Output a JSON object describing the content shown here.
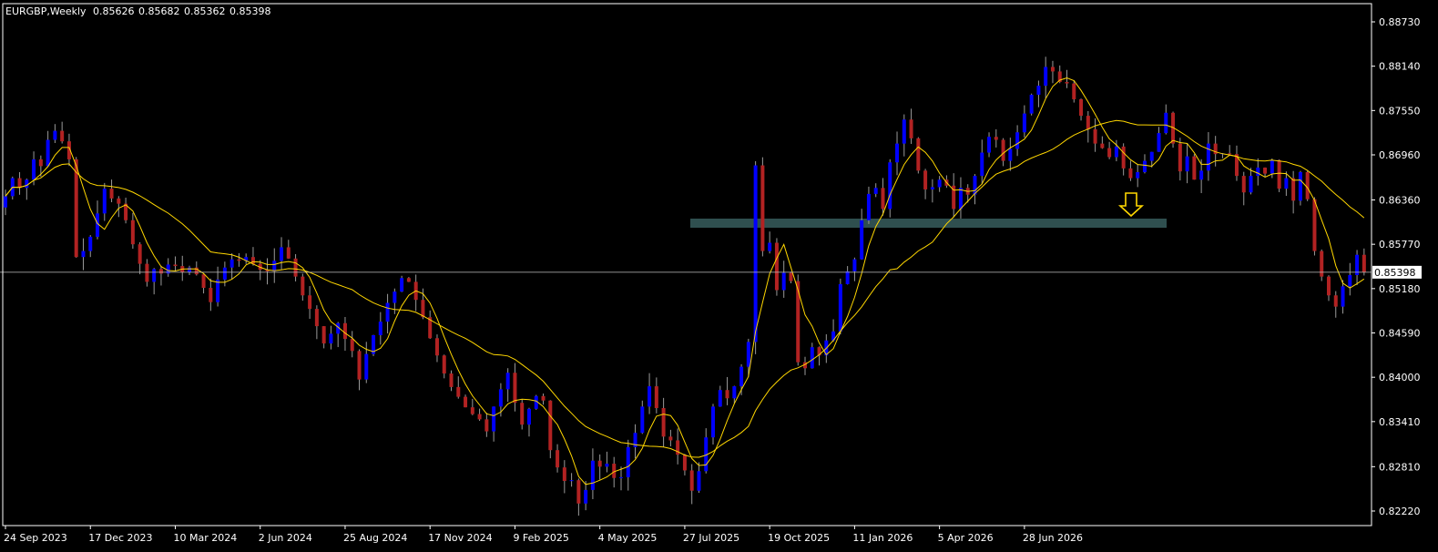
{
  "header": {
    "symbol": "EURGBP,Weekly",
    "ohlc": [
      "0.85626",
      "0.85682",
      "0.85362",
      "0.85398"
    ]
  },
  "colors": {
    "background": "#000000",
    "bull_candle": "#0000ff",
    "bear_candle": "#b22222",
    "wick": "#9a9a9a",
    "moving_averages": "#ffd700",
    "zone": "#2f4f4f",
    "arrow": "#ffd700",
    "price_line": "#c0c0c0",
    "axis": "#ffffff"
  },
  "icons": {
    "arrow": "down-arrow-icon"
  },
  "chart_data": {
    "type": "candlestick",
    "title": "EURGBP,Weekly",
    "ylim": [
      0.8196,
      0.8888
    ],
    "y_ticks": [
      "0.88730",
      "0.88140",
      "0.87550",
      "0.86960",
      "0.86360",
      "0.85770",
      "0.85180",
      "0.84590",
      "0.84000",
      "0.83410",
      "0.82810",
      "0.82220"
    ],
    "x_ticks": [
      "24 Sep 2023",
      "17 Dec 2023",
      "10 Mar 2024",
      "2 Jun 2024",
      "25 Aug 2024",
      "17 Nov 2024",
      "9 Feb 2025",
      "4 May 2025",
      "27 Jul 2025",
      "19 Oct 2025",
      "11 Jan 2026",
      "5 Apr 2026",
      "28 Jun 2026"
    ],
    "x_tick_bar_index": [
      0,
      12,
      24,
      36,
      48,
      60,
      72,
      84,
      96,
      108,
      120,
      132,
      144
    ],
    "current_price": "0.85398",
    "close": [
      0.8641,
      0.8665,
      0.8652,
      0.8663,
      0.869,
      0.8681,
      0.8716,
      0.8728,
      0.8714,
      0.869,
      0.856,
      0.8568,
      0.8587,
      0.8618,
      0.8651,
      0.8638,
      0.8631,
      0.8609,
      0.8577,
      0.8551,
      0.8527,
      0.8544,
      0.8538,
      0.855,
      0.8548,
      0.854,
      0.8546,
      0.8537,
      0.8519,
      0.85,
      0.853,
      0.8546,
      0.8557,
      0.8555,
      0.856,
      0.8551,
      0.8543,
      0.8541,
      0.8555,
      0.8573,
      0.8558,
      0.8534,
      0.8509,
      0.8491,
      0.8468,
      0.8445,
      0.8458,
      0.8472,
      0.8451,
      0.8435,
      0.8397,
      0.8431,
      0.8456,
      0.8474,
      0.8499,
      0.8514,
      0.8532,
      0.8527,
      0.8503,
      0.848,
      0.8452,
      0.8429,
      0.8405,
      0.8387,
      0.8374,
      0.836,
      0.8351,
      0.8344,
      0.8328,
      0.8361,
      0.8384,
      0.8406,
      0.8366,
      0.8337,
      0.8358,
      0.8375,
      0.8369,
      0.8303,
      0.828,
      0.8262,
      0.8263,
      0.8232,
      0.825,
      0.8289,
      0.8281,
      0.8285,
      0.8266,
      0.8267,
      0.8307,
      0.8326,
      0.8361,
      0.8388,
      0.8359,
      0.8321,
      0.8316,
      0.8297,
      0.8276,
      0.8249,
      0.8275,
      0.832,
      0.8361,
      0.8383,
      0.8372,
      0.8388,
      0.8414,
      0.8447,
      0.8682,
      0.8568,
      0.8579,
      0.8516,
      0.8539,
      0.8528,
      0.842,
      0.8412,
      0.844,
      0.8429,
      0.8449,
      0.8461,
      0.8524,
      0.8541,
      0.8557,
      0.8609,
      0.8644,
      0.8652,
      0.8624,
      0.8686,
      0.8711,
      0.8743,
      0.8718,
      0.8675,
      0.865,
      0.8653,
      0.8663,
      0.8655,
      0.8624,
      0.8652,
      0.8643,
      0.8668,
      0.8699,
      0.872,
      0.8716,
      0.8688,
      0.8704,
      0.8726,
      0.8751,
      0.8776,
      0.8788,
      0.8813,
      0.8807,
      0.8793,
      0.8791,
      0.877,
      0.8748,
      0.873,
      0.8711,
      0.8705,
      0.8693,
      0.8707,
      0.8678,
      0.8665,
      0.8673,
      0.8688,
      0.87,
      0.8725,
      0.8752,
      0.8711,
      0.8674,
      0.8694,
      0.8663,
      0.8675,
      0.8711,
      0.8697,
      0.8698,
      0.8697,
      0.8668,
      0.8646,
      0.8668,
      0.8679,
      0.8671,
      0.8689,
      0.8651,
      0.8665,
      0.8635,
      0.8673,
      0.8637,
      0.8568,
      0.8534,
      0.8509,
      0.8494,
      0.8521,
      0.8536,
      0.8563,
      0.854
    ]
  },
  "annotations": {
    "zone": "resistance-support-zone",
    "arrow": "down-arrow-icon"
  }
}
